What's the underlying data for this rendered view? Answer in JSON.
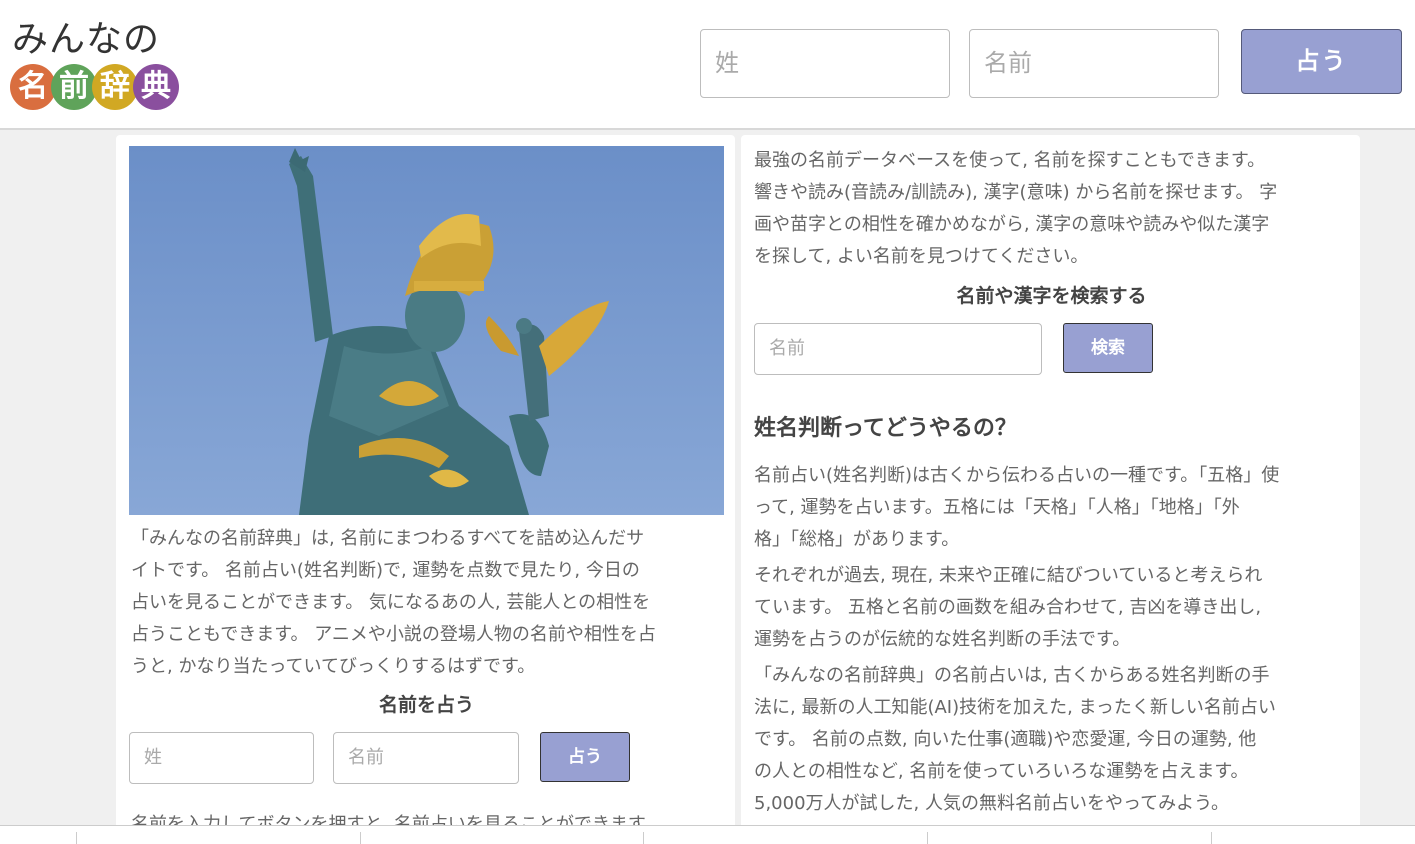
{
  "header": {
    "logo_top": "みんなの",
    "logo_chars": [
      {
        "char": "名",
        "color": "#d96e3f"
      },
      {
        "char": "前",
        "color": "#5fa35a"
      },
      {
        "char": "辞",
        "color": "#d1a823"
      },
      {
        "char": "典",
        "color": "#8a4f9e"
      }
    ],
    "surname_placeholder": "姓",
    "name_placeholder": "名前",
    "fortune_button": "占う"
  },
  "left": {
    "hero_image": "statue-image",
    "intro_lines": [
      "「みんなの名前辞典」は, 名前にまつわるすべてを詰め込んだサ",
      "イトです。 名前占い(姓名判断)で, 運勢を点数で見たり, 今日の",
      "占いを見ることができます。 気になるあの人, 芸能人との相性を",
      "占うこともできます。 アニメや小説の登場人物の名前や相性を占",
      "うと, かなり当たっていてびっくりするはずです。"
    ],
    "fortune_heading": "名前を占う",
    "surname_placeholder": "姓",
    "name_placeholder": "名前",
    "fortune_button": "占う",
    "cutoff_text": "名前を入力してボタンを押すと, 名前占いを見ることができます"
  },
  "right": {
    "db_lines": [
      "最強の名前データベースを使って, 名前を探すこともできます。",
      "響きや読み(音読み/訓読み), 漢字(意味) から名前を探せます。 字",
      "画や苗字との相性を確かめながら, 漢字の意味や読みや似た漢字",
      "を探して, よい名前を見つけてください。"
    ],
    "search_heading": "名前や漢字を検索する",
    "search_placeholder": "名前",
    "search_button": "検索",
    "section_title": "姓名判断ってどうやるの？",
    "para1_lines": [
      "名前占い(姓名判断)は古くから伝わる占いの一種です。「五格」使",
      "って, 運勢を占います。五格には「天格」「人格」「地格」「外",
      "格」「総格」があります。"
    ],
    "para2_lines": [
      "それぞれが過去, 現在, 未来や正確に結びついていると考えられ",
      "ています。 五格と名前の画数を組み合わせて, 吉凶を導き出し,",
      "運勢を占うのが伝統的な姓名判断の手法です。"
    ],
    "para3_lines": [
      "「みんなの名前辞典」の名前占いは, 古くからある姓名判断の手",
      "法に, 最新の人工知能(AI)技術を加えた, まったく新しい名前占い",
      "です。 名前の点数, 向いた仕事(適職)や恋愛運, 今日の運勢, 他",
      "の人との相性など, 名前を使っていろいろな運勢を占えます。",
      "5,000万人が試した, 人気の無料名前占いをやってみよう。"
    ]
  }
}
